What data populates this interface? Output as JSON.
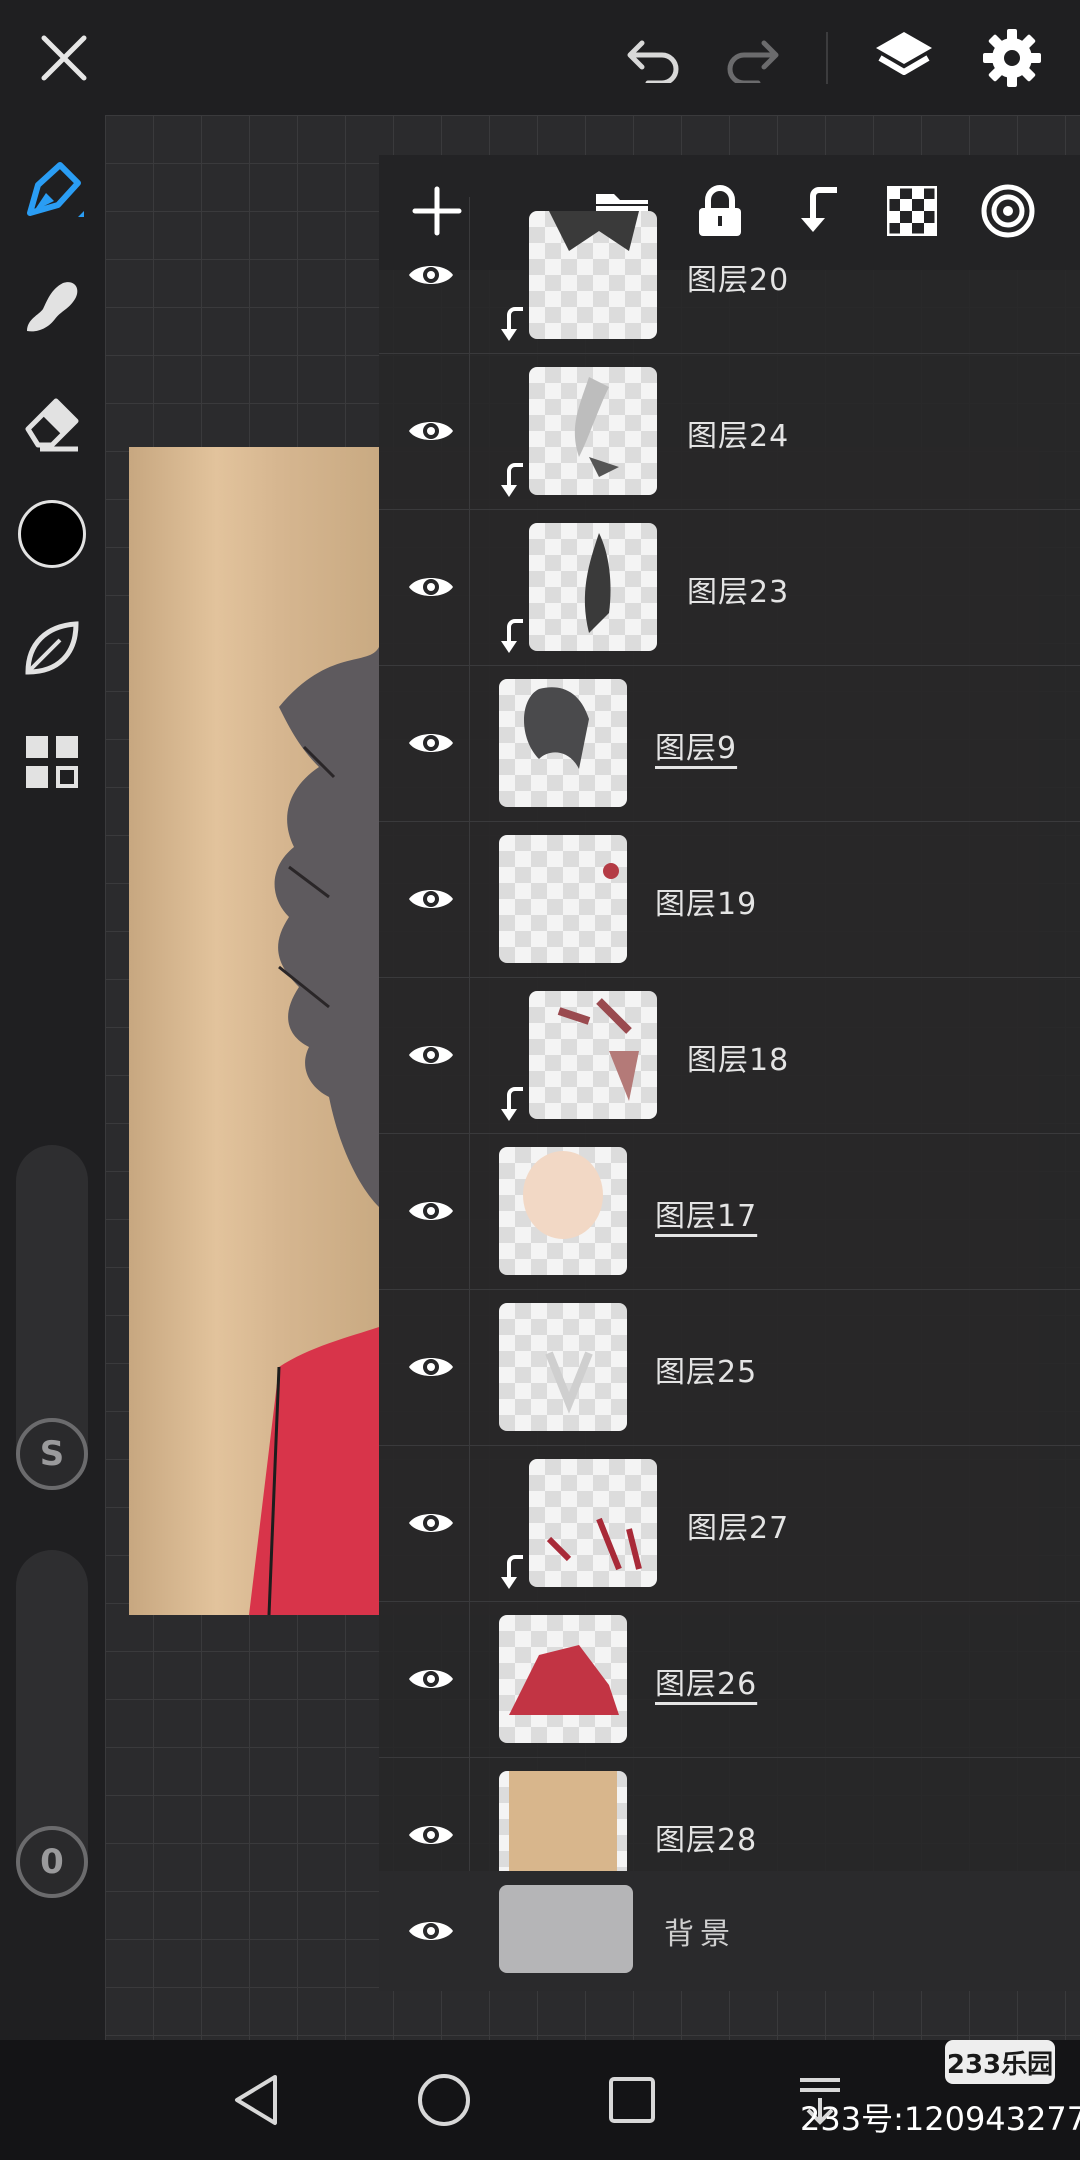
{
  "layers": [
    {
      "name": "图层20",
      "clipped": true,
      "underlined": false
    },
    {
      "name": "图层24",
      "clipped": true,
      "underlined": false
    },
    {
      "name": "图层23",
      "clipped": true,
      "underlined": false
    },
    {
      "name": "图层9",
      "clipped": false,
      "underlined": true
    },
    {
      "name": "图层19",
      "clipped": false,
      "underlined": false
    },
    {
      "name": "图层18",
      "clipped": true,
      "underlined": false
    },
    {
      "name": "图层17",
      "clipped": false,
      "underlined": true
    },
    {
      "name": "图层25",
      "clipped": false,
      "underlined": false
    },
    {
      "name": "图层27",
      "clipped": true,
      "underlined": false
    },
    {
      "name": "图层26",
      "clipped": false,
      "underlined": true
    },
    {
      "name": "图层28",
      "clipped": false,
      "underlined": false
    }
  ],
  "background_layer": {
    "name": "背景"
  },
  "left_toolbar": {
    "size_knob_label": "S",
    "opacity_knob_label": "0"
  },
  "current_color": "#000000",
  "accent_color": "#2a9df4",
  "watermark": {
    "badge": "233乐园",
    "id_text": "233号:120943277"
  },
  "icons": {
    "top": [
      "close-icon",
      "undo-icon",
      "redo-icon",
      "layers-icon",
      "settings-icon"
    ],
    "panel": [
      "add-layer-icon",
      "folder-icon",
      "lock-icon",
      "clip-mask-icon",
      "transparency-icon",
      "blend-icon"
    ],
    "nav": [
      "back-icon",
      "home-icon",
      "recents-icon",
      "download-icon"
    ]
  }
}
